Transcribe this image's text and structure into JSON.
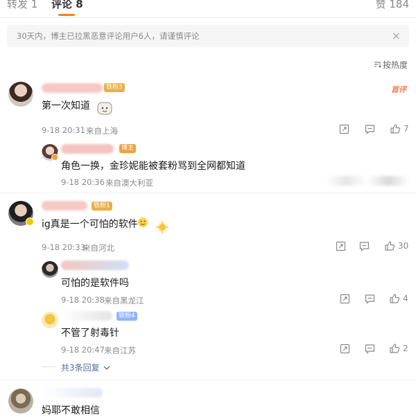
{
  "tabs": {
    "repost": "转发 1",
    "comment": "评论 8",
    "like": "赞 184"
  },
  "notice": {
    "text": "30天内，博主已拉黑恶意评论用户6人，请谨慎评论",
    "close": "×"
  },
  "sort": {
    "icon": "sort-icon",
    "label": "按热度"
  },
  "comments": [
    {
      "badge": "铁粉3",
      "tag": "首评",
      "text": "第一次知道",
      "time": "9-18 20:31",
      "location": "来自上海",
      "likes": "7",
      "replies": [
        {
          "badge": "博主",
          "text": "角色一换，金珍妮能被套粉骂到全网都知道",
          "time": "9-18 20:36",
          "location": "来自澳大利亚"
        }
      ]
    },
    {
      "badge": "铁粉1",
      "text": "ig真是一个可怕的软件",
      "time": "9-18 20:33",
      "location": "来自河北",
      "likes": "30",
      "replies": [
        {
          "text": "可怕的是软件吗",
          "time": "9-18 20:38",
          "location": "来自黑龙江",
          "likes": "4"
        },
        {
          "badge": "铁粉4",
          "text": "不管了射毒针",
          "time": "9-18 20:47",
          "location": "来自江苏",
          "likes": "2"
        }
      ],
      "more_replies": "共3条回复"
    },
    {
      "text": "妈耶不敢相信"
    }
  ],
  "colors": {
    "accent": "#ff8200",
    "link": "#4f6d95",
    "meta": "#8a8a8a"
  }
}
